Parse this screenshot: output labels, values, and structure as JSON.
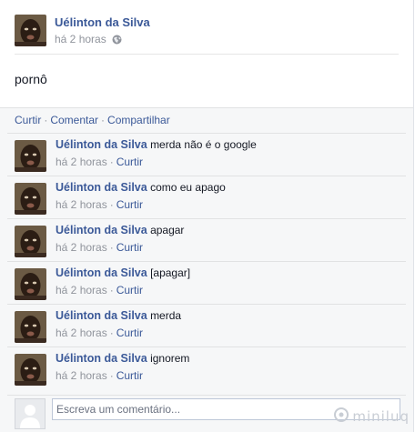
{
  "post": {
    "author": "Uélinton da Silva",
    "time": "há 2 horas",
    "privacy_icon": "globe-icon",
    "text": "pornô"
  },
  "actions": {
    "like": "Curtir",
    "comment": "Comentar",
    "share": "Compartilhar",
    "separator": "·"
  },
  "comments": [
    {
      "author": "Uélinton da Silva",
      "text": "merda não é o google",
      "time": "há 2 horas",
      "like": "Curtir"
    },
    {
      "author": "Uélinton da Silva",
      "text": "como eu apago",
      "time": "há 2 horas",
      "like": "Curtir"
    },
    {
      "author": "Uélinton da Silva",
      "text": "apagar",
      "time": "há 2 horas",
      "like": "Curtir"
    },
    {
      "author": "Uélinton da Silva",
      "text": "[apagar]",
      "time": "há 2 horas",
      "like": "Curtir"
    },
    {
      "author": "Uélinton da Silva",
      "text": "merda",
      "time": "há 2 horas",
      "like": "Curtir"
    },
    {
      "author": "Uélinton da Silva",
      "text": "ignorem",
      "time": "há 2 horas",
      "like": "Curtir"
    }
  ],
  "composer": {
    "placeholder": "Escreva um comentário..."
  },
  "watermark": {
    "text": "miniluq"
  },
  "colors": {
    "link": "#3b5998",
    "meta": "#90949c",
    "ufi_background": "#f6f7f8"
  }
}
